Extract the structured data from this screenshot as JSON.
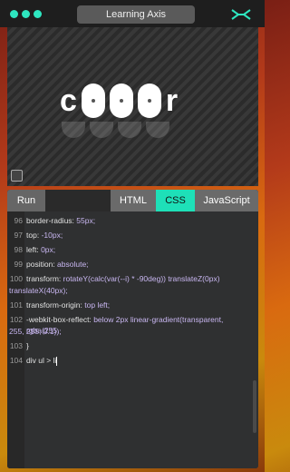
{
  "window": {
    "title": "Learning Axis",
    "dot_colors": [
      "#2ee6c0",
      "#2ee6c0",
      "#2ee6c0"
    ],
    "logo_icon": "crossed-arrows-icon",
    "accent": "#1ee0b8"
  },
  "preview": {
    "text_left": "c",
    "text_right": "r",
    "expand_icon": "expand-icon"
  },
  "tabs": {
    "run": "Run",
    "html": "HTML",
    "css": "CSS",
    "js": "JavaScript",
    "active": "CSS"
  },
  "code": {
    "lines": [
      {
        "num": "96",
        "prop": "border-radius:",
        "val": "55px;"
      },
      {
        "num": "97",
        "prop": "top:",
        "val": "-10px;"
      },
      {
        "num": "98",
        "prop": "left:",
        "val": "0px;"
      },
      {
        "num": "99",
        "prop": "position:",
        "val": "absolute;"
      },
      {
        "num": "100",
        "prop": "transform:",
        "val": "rotateY(calc(var(--i) * -90deg)) translateZ(0px)",
        "cont": "translateX(40px);"
      },
      {
        "num": "101",
        "prop": "transform-origin:",
        "val": "top left;"
      },
      {
        "num": "102",
        "prop": "-webkit-box-reflect:",
        "val": "below 2px linear-gradient(transparent, rgba(255,",
        "cont": "255, 255, 0.1));"
      },
      {
        "num": "103",
        "prop": "}",
        "val": ""
      },
      {
        "num": "104",
        "prop": "div ul > li",
        "val": ""
      }
    ]
  }
}
